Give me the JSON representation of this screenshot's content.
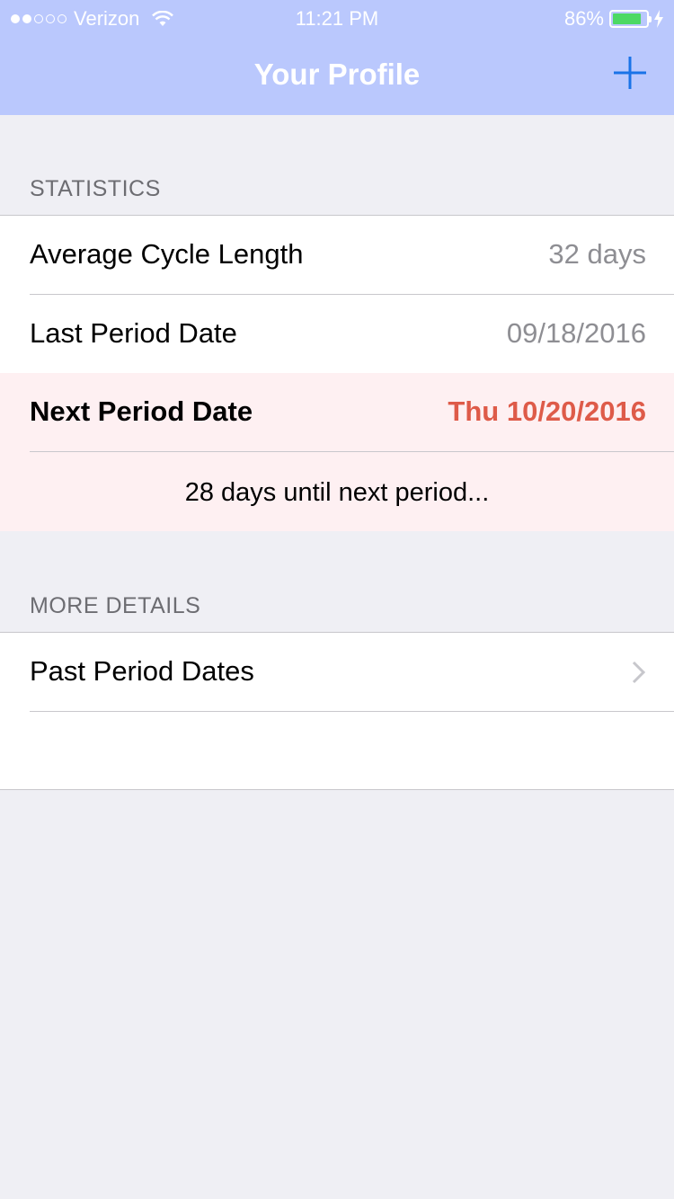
{
  "status_bar": {
    "carrier": "Verizon",
    "time": "11:21 PM",
    "battery_percent": "86%",
    "battery_level": 0.86,
    "signal_strength": 2,
    "signal_max": 5
  },
  "nav": {
    "title": "Your Profile",
    "add_icon": "plus-icon"
  },
  "statistics": {
    "header": "STATISTICS",
    "rows": [
      {
        "label": "Average Cycle Length",
        "value": "32 days"
      },
      {
        "label": "Last Period Date",
        "value": "09/18/2016"
      },
      {
        "label": "Next Period Date",
        "value": "Thu 10/20/2016"
      }
    ],
    "countdown": "28 days until next period..."
  },
  "more_details": {
    "header": "MORE DETAILS",
    "rows": [
      {
        "label": "Past Period Dates",
        "icon": "chevron-right-icon"
      }
    ]
  },
  "colors": {
    "nav_bar": "#bac8fd",
    "accent": "#1a73e8",
    "highlight_bg": "#fef0f2",
    "next_date": "#de5b49",
    "battery": "#4cd964"
  }
}
